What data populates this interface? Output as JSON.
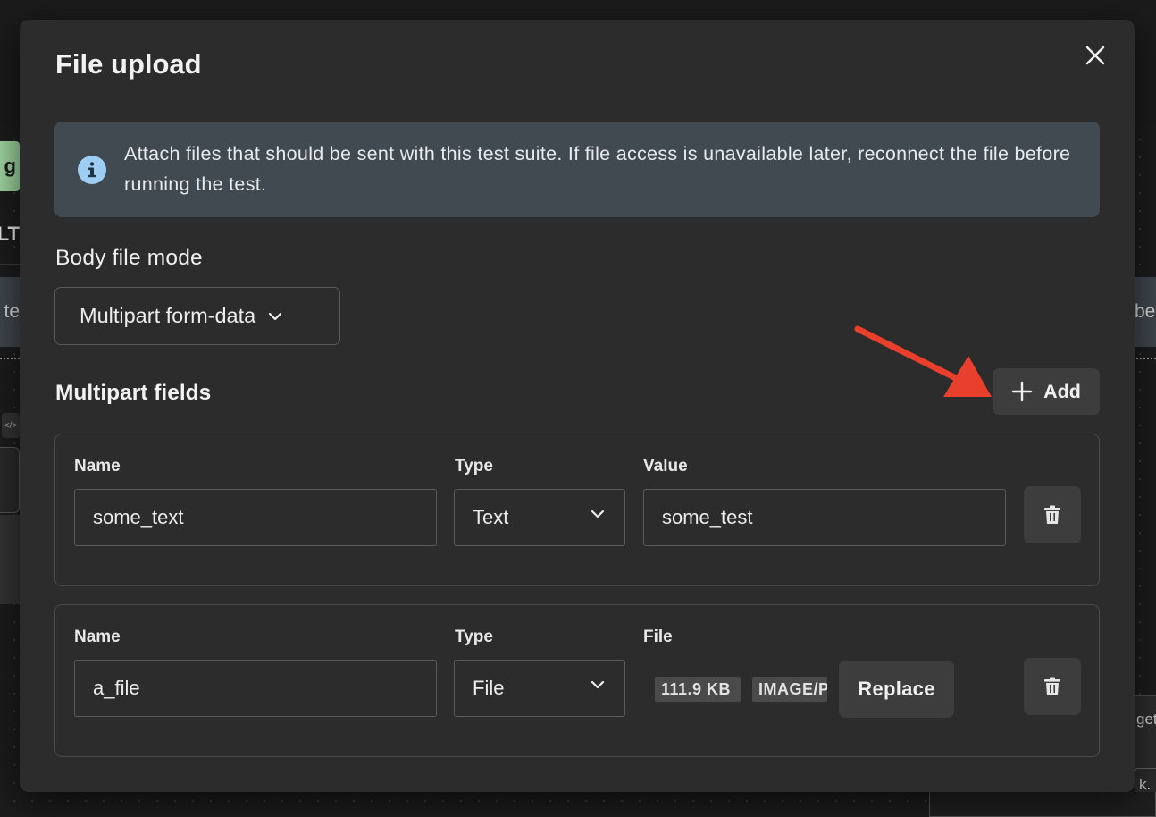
{
  "background": {
    "green_tab_text": "g",
    "header_fragment": "LT",
    "banner_left_fragment": "te",
    "banner_right_fragment": "be",
    "code_chip": "</>",
    "right_box_line1": "get",
    "right_box_line2": "k."
  },
  "modal": {
    "title": "File upload",
    "info_text": "Attach files that should be sent with this test suite. If file access is unavailable later, reconnect the file before running the test.",
    "body_file_mode_label": "Body file mode",
    "body_file_mode_value": "Multipart form-data",
    "multipart_fields_title": "Multipart fields",
    "add_label": "Add",
    "fields": [
      {
        "name_label": "Name",
        "type_label": "Type",
        "value_label": "Value",
        "name": "some_text",
        "type": "Text",
        "value": "some_test"
      },
      {
        "name_label": "Name",
        "type_label": "Type",
        "file_label": "File",
        "name": "a_file",
        "type": "File",
        "file_size": "111.9 KB",
        "file_type": "IMAGE/PNG",
        "replace_label": "Replace"
      }
    ]
  },
  "colors": {
    "modal_bg": "#2c2c2c",
    "info_bg": "#414951",
    "info_icon": "#9fcdf2",
    "arrow": "#e8402c",
    "button_bg": "#3d3d3d"
  }
}
